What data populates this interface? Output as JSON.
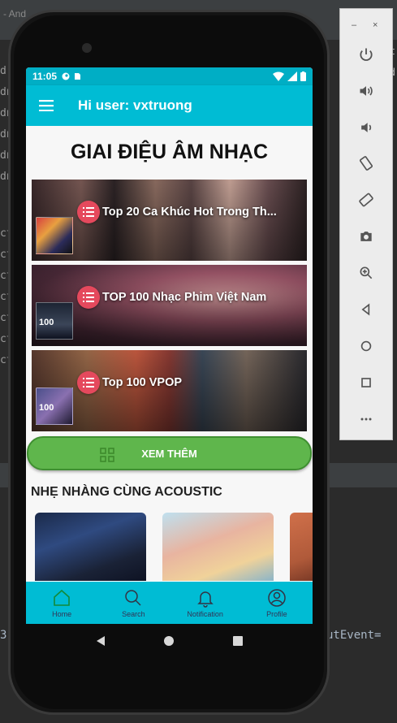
{
  "ide": {
    "title_fragment": "- And",
    "code_prefixes": [
      "dr",
      "dn",
      "dn",
      "dn",
      "dn",
      "dn",
      "ct",
      "ct",
      "ct",
      "ct",
      "ct",
      "ct",
      "ct"
    ],
    "log_left": "3",
    "log_right": "utEvent=",
    "right_edge_texts": [
      "t",
      "d",
      "d",
      "d"
    ]
  },
  "emulator_toolbar": {
    "minimize_label": "–",
    "close_label": "×",
    "buttons": [
      "power-icon",
      "volume-up-icon",
      "volume-down-icon",
      "rotate-left-icon",
      "rotate-right-icon",
      "camera-icon",
      "zoom-icon",
      "back-icon",
      "home-icon",
      "overview-icon",
      "more-icon"
    ]
  },
  "status_bar": {
    "time": "11:05"
  },
  "app_bar": {
    "title": "Hi user: vxtruong"
  },
  "main": {
    "heading": "GIAI ĐIỆU ÂM NHẠC",
    "playlists": [
      {
        "title": "Top 20 Ca Khúc Hot Trong Th..."
      },
      {
        "title": "TOP 100 Nhạc Phim Việt Nam",
        "thumb_text": "100"
      },
      {
        "title": "Top 100 VPOP",
        "thumb_text": "100"
      }
    ],
    "more_button": "XEM THÊM",
    "section_title": "NHẸ NHÀNG CÙNG ACOUSTIC"
  },
  "bottom_nav": {
    "items": [
      {
        "label": "Home",
        "icon": "home-icon"
      },
      {
        "label": "Search",
        "icon": "search-icon"
      },
      {
        "label": "Notification",
        "icon": "bell-icon"
      },
      {
        "label": "Profile",
        "icon": "profile-icon"
      }
    ]
  },
  "colors": {
    "primary": "#00bcd4",
    "status_bar": "#00aec5",
    "accent_button": "#5fb64c",
    "badge": "#e5495d"
  }
}
